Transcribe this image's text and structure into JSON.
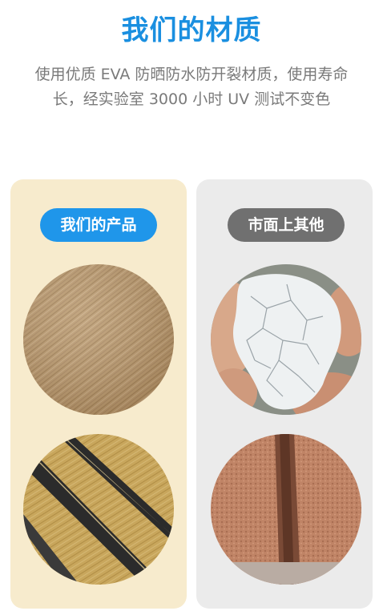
{
  "header": {
    "title": "我们的材质",
    "description": "使用优质 EVA 防晒防水防开裂材质，使用寿命长，经实验室 3000 小时 UV 测试不变色"
  },
  "comparison": {
    "ours": {
      "label": "我们的产品"
    },
    "others": {
      "label": "市面上其他"
    }
  },
  "colors": {
    "title": "#1a8fe0",
    "ours_pill": "#1f96ea",
    "others_pill": "#707070",
    "ours_panel": "#f7ebcd",
    "others_panel": "#ebebeb"
  }
}
